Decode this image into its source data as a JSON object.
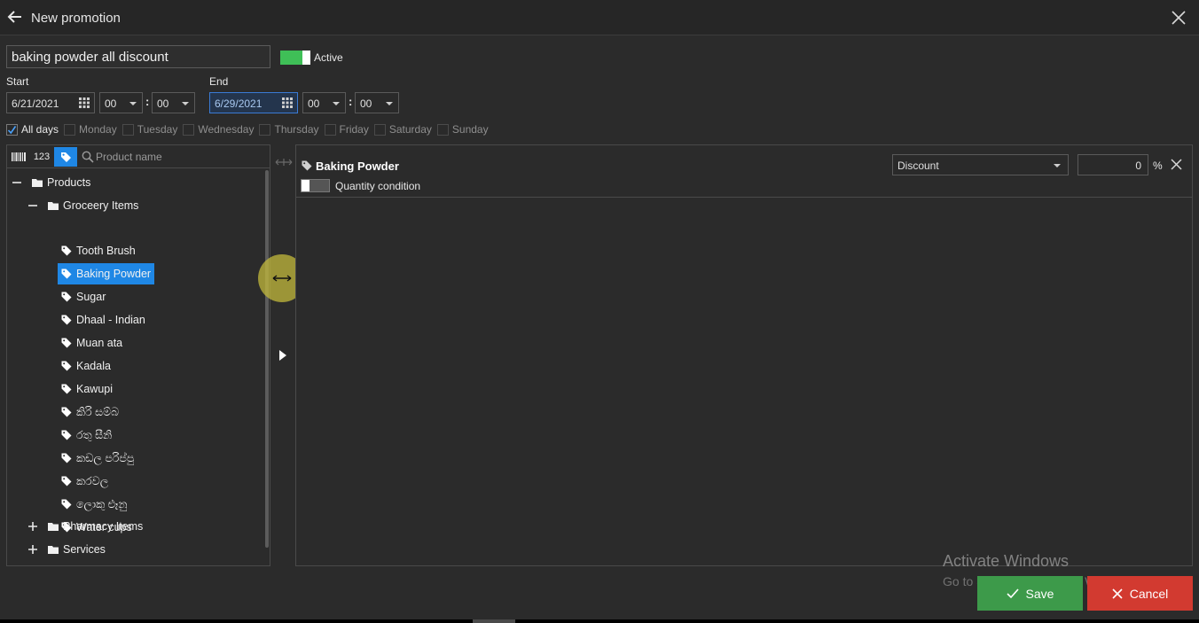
{
  "header": {
    "title": "New promotion"
  },
  "promotion": {
    "name": "baking powder all discount",
    "active_label": "Active",
    "active": true
  },
  "schedule": {
    "start_label": "Start",
    "end_label": "End",
    "start_date": "6/21/2021",
    "start_hour": "00",
    "start_minute": "00",
    "end_date": "6/29/2021",
    "end_hour": "00",
    "end_minute": "00",
    "separator": ":"
  },
  "days": [
    {
      "label": "All days",
      "checked": true
    },
    {
      "label": "Monday",
      "checked": false
    },
    {
      "label": "Tuesday",
      "checked": false
    },
    {
      "label": "Wednesday",
      "checked": false
    },
    {
      "label": "Thursday",
      "checked": false
    },
    {
      "label": "Friday",
      "checked": false
    },
    {
      "label": "Saturday",
      "checked": false
    },
    {
      "label": "Sunday",
      "checked": false
    }
  ],
  "product_panel": {
    "numeric_button": "123",
    "search_placeholder": "Product name",
    "tree": {
      "root": "Products",
      "groceries": "Groceery Items",
      "items": [
        "Tooth Brush",
        "Baking Powder",
        "Sugar",
        "Dhaal - Indian",
        "Muan ata",
        "Kadala",
        "Kawupi",
        "කිරි සම්බ",
        "රතු සීනි",
        "කඩල පරිප්පු",
        "කරවල",
        "ලොකු ළූනු",
        "Water cups"
      ],
      "selected": "Baking Powder",
      "pharmacy": "Pharmacy Items",
      "services": "Services"
    }
  },
  "detail_panel": {
    "product": "Baking Powder",
    "quantity_condition_label": "Quantity condition",
    "type_selected": "Discount",
    "value": "0",
    "unit": "%"
  },
  "watermark": {
    "line1": "Activate Windows",
    "line2": "Go to Settings to activate Windows."
  },
  "actions": {
    "save": "Save",
    "cancel": "Cancel"
  },
  "colors": {
    "accent": "#1f87e5",
    "save": "#3d9a4a",
    "cancel": "#d23a30",
    "toggle_on": "#3fbf57"
  }
}
